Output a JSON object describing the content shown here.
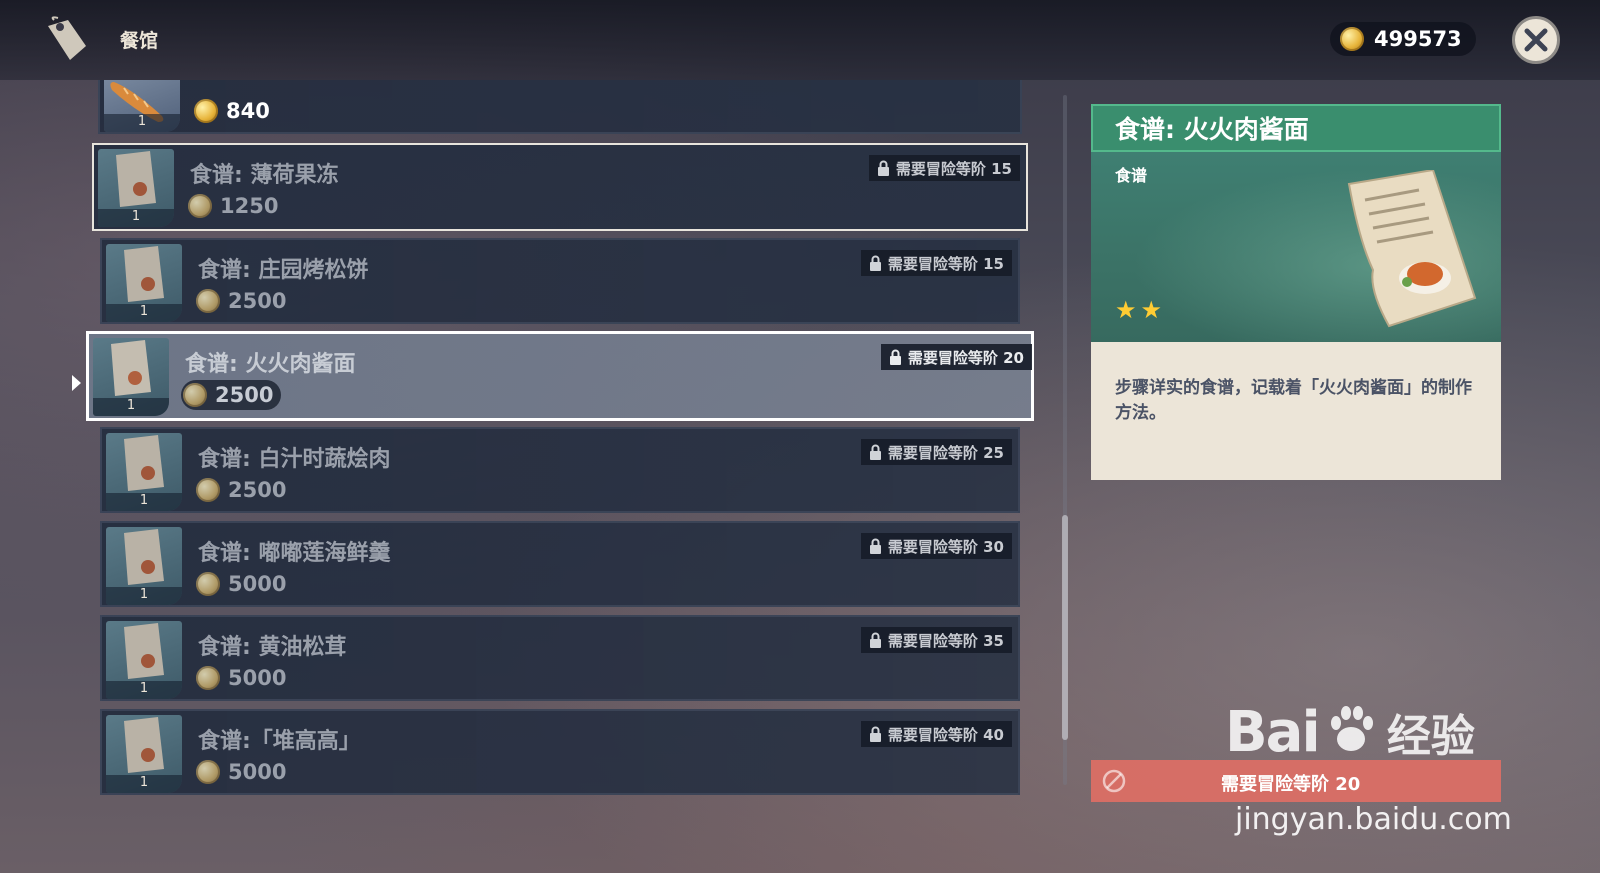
{
  "header": {
    "title": "餐馆",
    "shop_icon": "price-tag-icon",
    "currency_icon": "mora-coin-icon",
    "currency_amount": "499573",
    "close_icon": "close-icon"
  },
  "items": [
    {
      "name": "",
      "price": "840",
      "count": "1",
      "requirement": ""
    },
    {
      "name": "食谱: 薄荷果冻",
      "price": "1250",
      "count": "1",
      "requirement": "需要冒险等阶 15"
    },
    {
      "name": "食谱: 庄园烤松饼",
      "price": "2500",
      "count": "1",
      "requirement": "需要冒险等阶 15"
    },
    {
      "name": "食谱: 火火肉酱面",
      "price": "2500",
      "count": "1",
      "requirement": "需要冒险等阶 20"
    },
    {
      "name": "食谱: 白汁时蔬烩肉",
      "price": "2500",
      "count": "1",
      "requirement": "需要冒险等阶 25"
    },
    {
      "name": "食谱: 嘟嘟莲海鲜羹",
      "price": "5000",
      "count": "1",
      "requirement": "需要冒险等阶 30"
    },
    {
      "name": "食谱: 黄油松茸",
      "price": "5000",
      "count": "1",
      "requirement": "需要冒险等阶 35"
    },
    {
      "name": "食谱:「堆高高」",
      "price": "5000",
      "count": "1",
      "requirement": "需要冒险等阶 40"
    }
  ],
  "selected_index": 3,
  "detail": {
    "title": "食谱: 火火肉酱面",
    "category": "食谱",
    "rarity_stars": 2,
    "description": "步骤详实的食谱，记载着「火火肉酱面」的制作方法。",
    "action_label": "需要冒险等阶 20"
  },
  "watermark": {
    "brand": "Bai",
    "brand_cn": "经验",
    "url": "jingyan.baidu.com"
  },
  "colors": {
    "accent_green": "#3a8e6e",
    "action_red": "#e66e64",
    "star": "#ffcc33"
  }
}
